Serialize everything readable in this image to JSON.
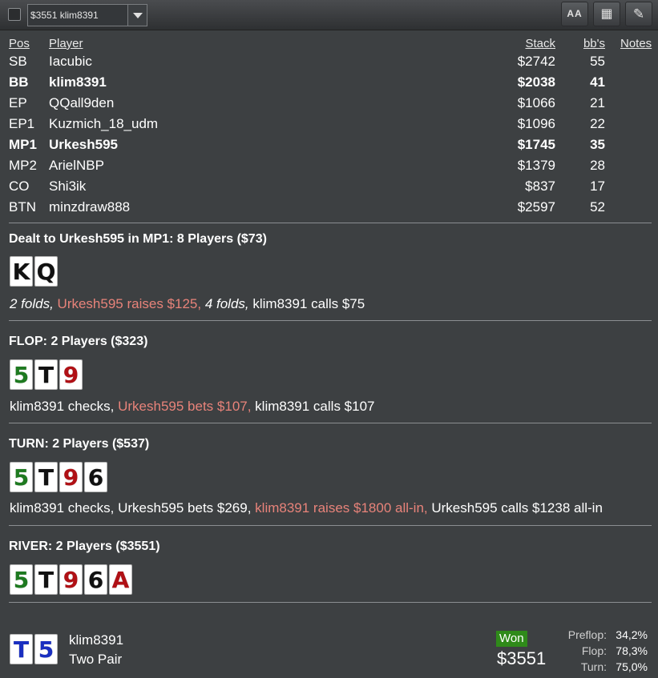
{
  "toolbar": {
    "hand_select_value": "$3551 klim8391",
    "font_button_label": "AA",
    "grid_button_icon": "grid-icon",
    "edit_button_icon": "pencil-icon"
  },
  "players_table": {
    "headers": {
      "pos": "Pos",
      "player": "Player",
      "stack": "Stack",
      "bbs": "bb's",
      "notes": "Notes"
    },
    "rows": [
      {
        "pos": "SB",
        "player": "Iacubic",
        "stack": "$2742",
        "bbs": "55"
      },
      {
        "pos": "BB",
        "player": "klim8391",
        "stack": "$2038",
        "bbs": "41"
      },
      {
        "pos": "EP",
        "player": "QQall9den",
        "stack": "$1066",
        "bbs": "21"
      },
      {
        "pos": "EP1",
        "player": "Kuzmich_18_udm",
        "stack": "$1096",
        "bbs": "22"
      },
      {
        "pos": "MP1",
        "player": "Urkesh595",
        "stack": "$1745",
        "bbs": "35"
      },
      {
        "pos": "MP2",
        "player": "ArielNBP",
        "stack": "$1379",
        "bbs": "28"
      },
      {
        "pos": "CO",
        "player": "Shi3ik",
        "stack": "$837",
        "bbs": "17"
      },
      {
        "pos": "BTN",
        "player": "minzdraw888",
        "stack": "$2597",
        "bbs": "52"
      }
    ]
  },
  "preflop": {
    "title": "Dealt to Urkesh595 in MP1: 8 Players ($73)",
    "cards": [
      "K",
      "Q"
    ],
    "actions": {
      "a1": "2 folds,",
      "a2": " Urkesh595 raises $125,",
      "a3": " 4 folds,",
      "a4": " klim8391 calls $75"
    }
  },
  "flop": {
    "title": "FLOP: 2 Players ($323)",
    "cards": [
      "5",
      "T",
      "9"
    ],
    "actions": {
      "a1": "klim8391 checks,",
      "a2": " Urkesh595 bets $107,",
      "a3": " klim8391 calls $107"
    }
  },
  "turn": {
    "title": "TURN: 2 Players ($537)",
    "cards": [
      "5",
      "T",
      "9",
      "6"
    ],
    "actions": {
      "a1": "klim8391 checks, Urkesh595 bets $269,",
      "a2": " klim8391 raises $1800 all-in,",
      "a3": " Urkesh595 calls $1238 all-in"
    }
  },
  "river": {
    "title": "RIVER: 2 Players ($3551)",
    "cards": [
      "5",
      "T",
      "9",
      "6",
      "A"
    ]
  },
  "summary": {
    "cards": [
      "T",
      "5"
    ],
    "player": "klim8391",
    "hand": "Two Pair",
    "won_label": "Won",
    "won_amount": "$3551",
    "equity": [
      {
        "label": "Preflop:",
        "value": "34,2%"
      },
      {
        "label": "Flop:",
        "value": "78,3%"
      },
      {
        "label": "Turn:",
        "value": "75,0%"
      }
    ]
  },
  "colors": {
    "background": "#3d4042",
    "highlight_action": "#e8837a",
    "won_badge": "#2f8a1a",
    "card_red": "#b01015",
    "card_green": "#1e7a20",
    "card_blue": "#1a2fc0"
  }
}
